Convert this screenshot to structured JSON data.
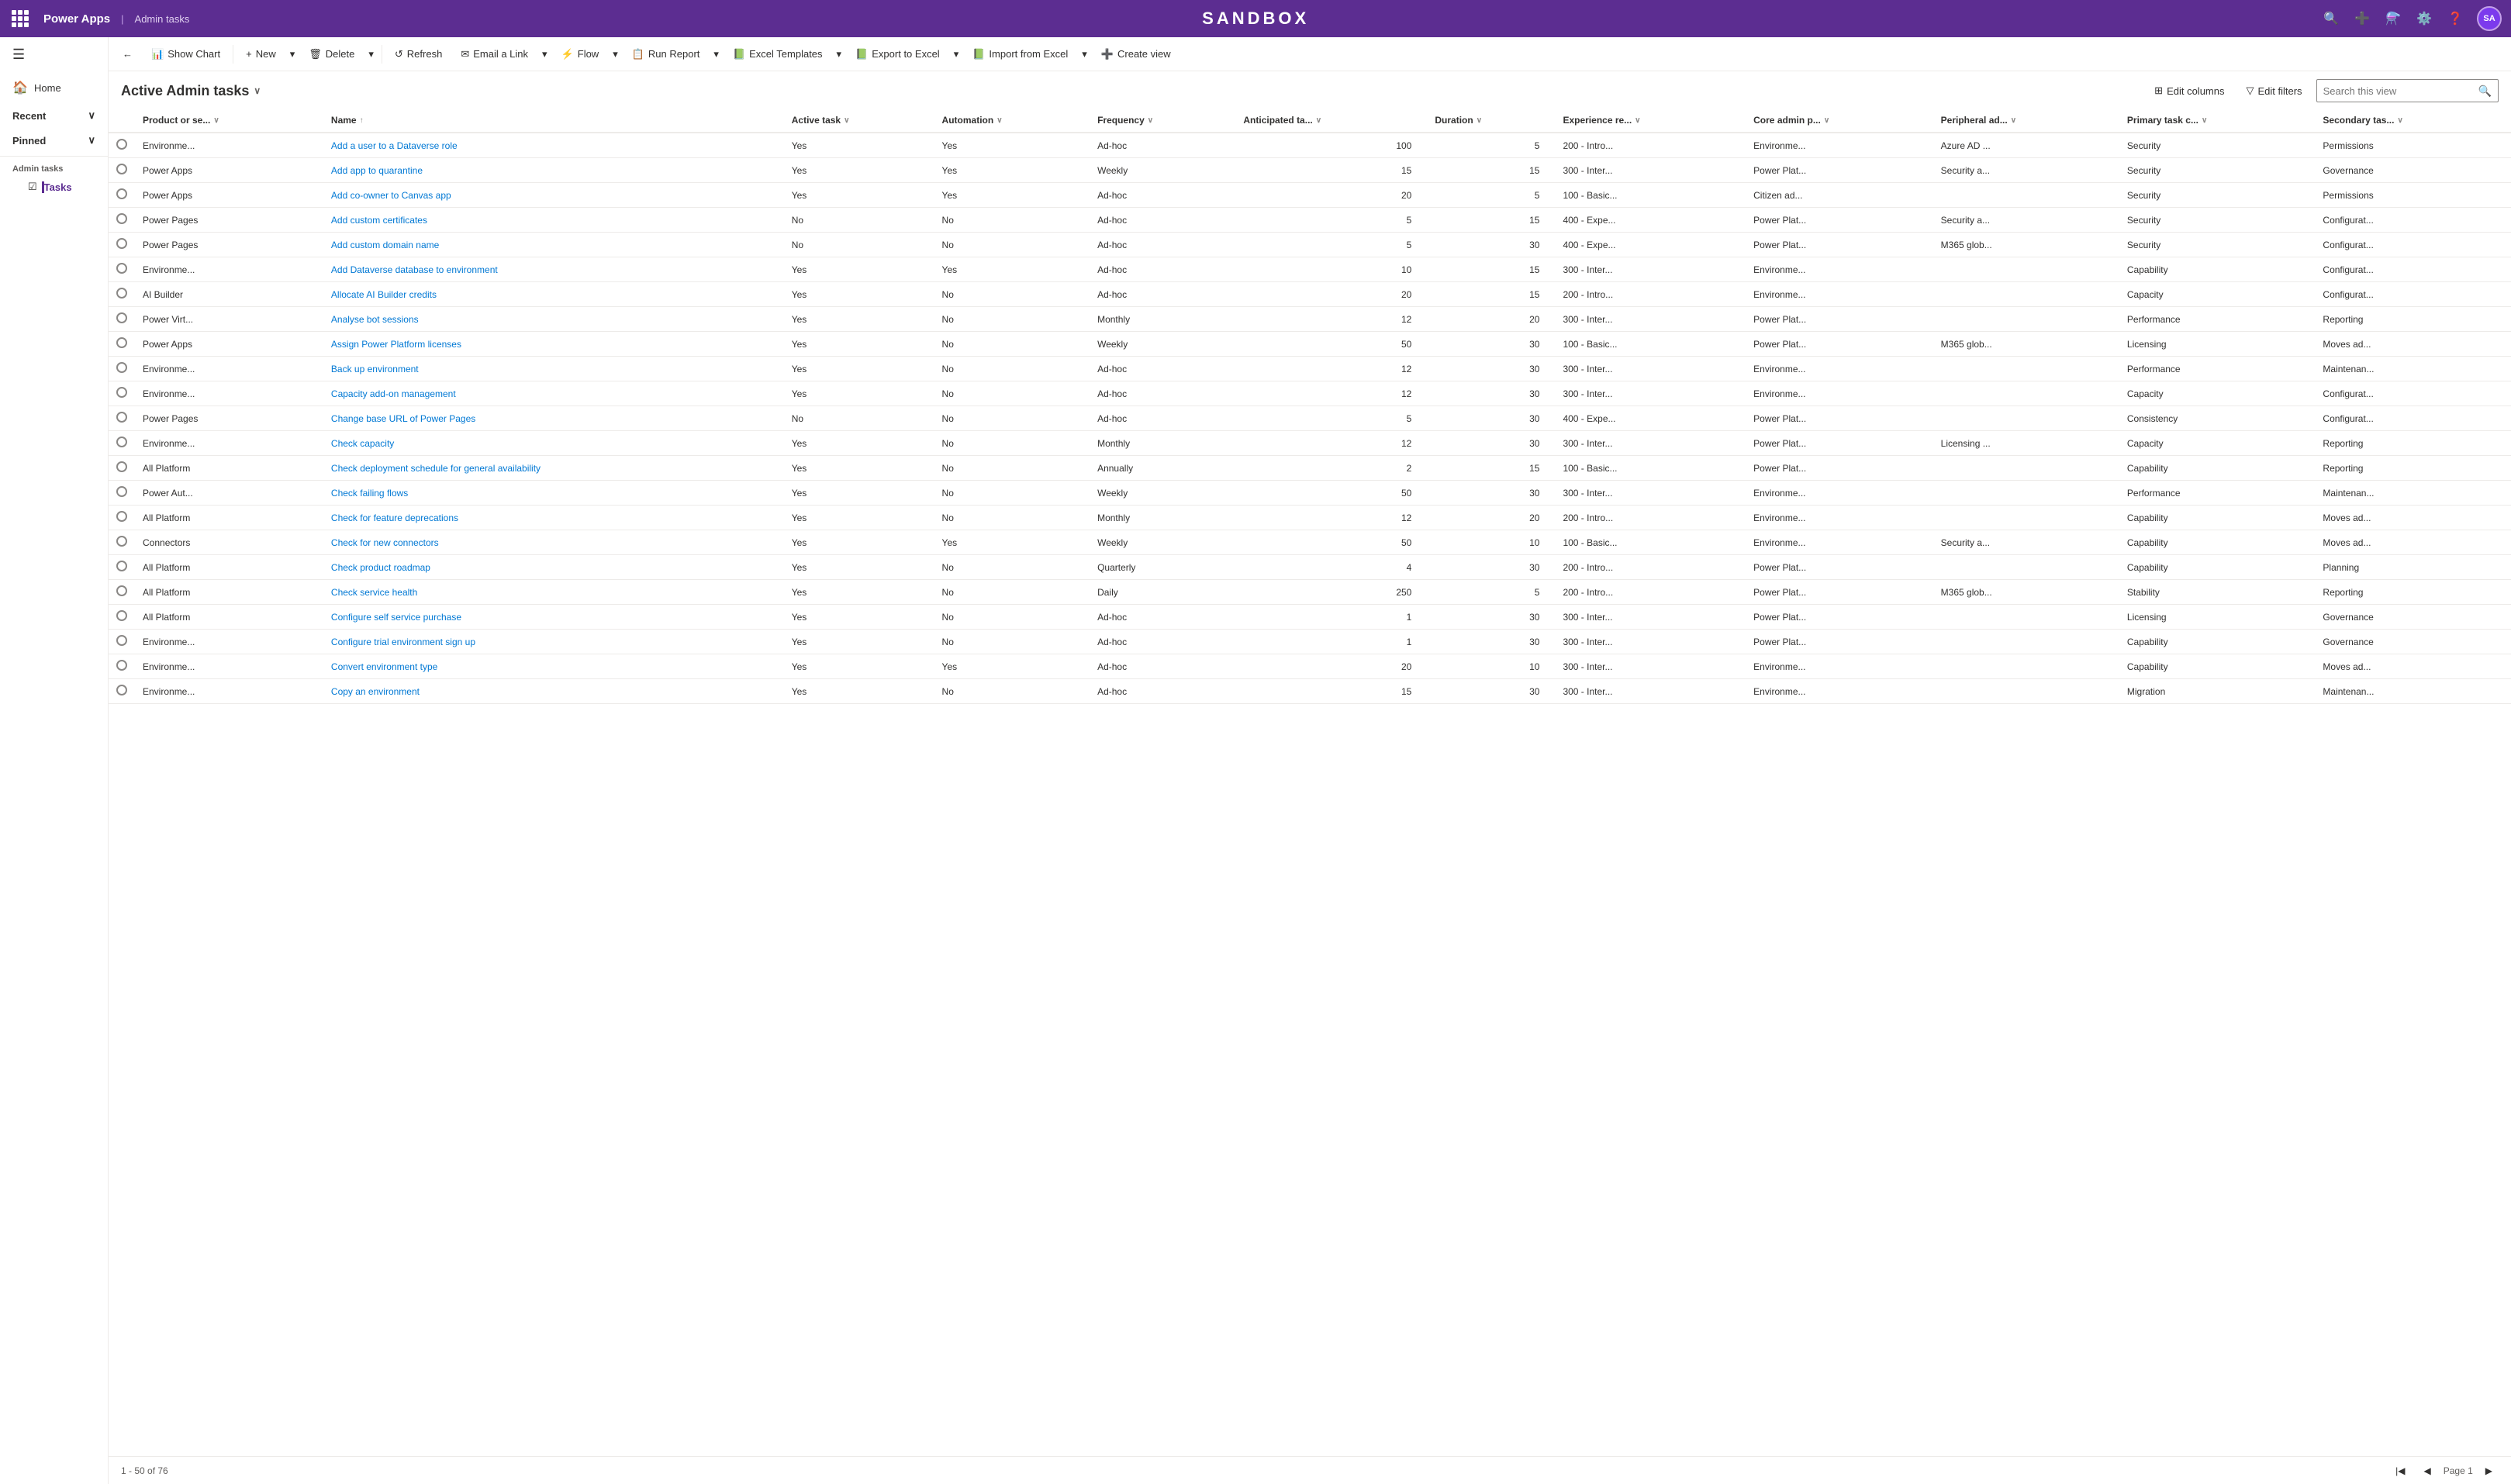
{
  "topNav": {
    "appName": "Power Apps",
    "breadcrumb": "Admin tasks",
    "title": "SANDBOX",
    "avatarText": "SA"
  },
  "sidebar": {
    "hamburgerLabel": "☰",
    "homeLabel": "Home",
    "recentLabel": "Recent",
    "pinnedLabel": "Pinned",
    "sectionLabel": "Admin tasks",
    "tasksLabel": "Tasks"
  },
  "commandBar": {
    "backLabel": "←",
    "showChartLabel": "Show Chart",
    "newLabel": "+ New",
    "deleteLabel": "🗑 Delete",
    "refreshLabel": "↺ Refresh",
    "emailLinkLabel": "✉ Email a Link",
    "flowLabel": "⚡ Flow",
    "runReportLabel": "📊 Run Report",
    "excelTemplatesLabel": "📋 Excel Templates",
    "exportExcelLabel": "📗 Export to Excel",
    "importExcelLabel": "📗 Import from Excel",
    "createViewLabel": "➕ Create view"
  },
  "viewHeader": {
    "title": "Active Admin tasks",
    "editColumnsLabel": "Edit columns",
    "editFiltersLabel": "Edit filters",
    "searchPlaceholder": "Search this view"
  },
  "columns": [
    {
      "id": "product",
      "label": "Product or se...",
      "width": "120"
    },
    {
      "id": "name",
      "label": "Name",
      "width": "260"
    },
    {
      "id": "active",
      "label": "Active task",
      "width": "80"
    },
    {
      "id": "automation",
      "label": "Automation",
      "width": "80"
    },
    {
      "id": "frequency",
      "label": "Frequency",
      "width": "90"
    },
    {
      "id": "anticipated",
      "label": "Anticipated ta...",
      "width": "110"
    },
    {
      "id": "duration",
      "label": "Duration",
      "width": "70"
    },
    {
      "id": "experience",
      "label": "Experience re...",
      "width": "110"
    },
    {
      "id": "coreAdmin",
      "label": "Core admin p...",
      "width": "110"
    },
    {
      "id": "peripheral",
      "label": "Peripheral ad...",
      "width": "100"
    },
    {
      "id": "primaryTask",
      "label": "Primary task c...",
      "width": "110"
    },
    {
      "id": "secondaryTask",
      "label": "Secondary tas...",
      "width": "110"
    }
  ],
  "rows": [
    {
      "product": "Environme...",
      "name": "Add a user to a Dataverse role",
      "active": "Yes",
      "automation": "Yes",
      "frequency": "Ad-hoc",
      "anticipated": "100",
      "duration": "5",
      "experience": "200 - Intro...",
      "coreAdmin": "Environme...",
      "peripheral": "Azure AD ...",
      "primaryTask": "Security",
      "secondaryTask": "Permissions"
    },
    {
      "product": "Power Apps",
      "name": "Add app to quarantine",
      "active": "Yes",
      "automation": "Yes",
      "frequency": "Weekly",
      "anticipated": "15",
      "duration": "15",
      "experience": "300 - Inter...",
      "coreAdmin": "Power Plat...",
      "peripheral": "Security a...",
      "primaryTask": "Security",
      "secondaryTask": "Governance"
    },
    {
      "product": "Power Apps",
      "name": "Add co-owner to Canvas app",
      "active": "Yes",
      "automation": "Yes",
      "frequency": "Ad-hoc",
      "anticipated": "20",
      "duration": "5",
      "experience": "100 - Basic...",
      "coreAdmin": "Citizen ad...",
      "peripheral": "",
      "primaryTask": "Security",
      "secondaryTask": "Permissions"
    },
    {
      "product": "Power Pages",
      "name": "Add custom certificates",
      "active": "No",
      "automation": "No",
      "frequency": "Ad-hoc",
      "anticipated": "5",
      "duration": "15",
      "experience": "400 - Expe...",
      "coreAdmin": "Power Plat...",
      "peripheral": "Security a...",
      "primaryTask": "Security",
      "secondaryTask": "Configurat..."
    },
    {
      "product": "Power Pages",
      "name": "Add custom domain name",
      "active": "No",
      "automation": "No",
      "frequency": "Ad-hoc",
      "anticipated": "5",
      "duration": "30",
      "experience": "400 - Expe...",
      "coreAdmin": "Power Plat...",
      "peripheral": "M365 glob...",
      "primaryTask": "Security",
      "secondaryTask": "Configurat..."
    },
    {
      "product": "Environme...",
      "name": "Add Dataverse database to environment",
      "active": "Yes",
      "automation": "Yes",
      "frequency": "Ad-hoc",
      "anticipated": "10",
      "duration": "15",
      "experience": "300 - Inter...",
      "coreAdmin": "Environme...",
      "peripheral": "",
      "primaryTask": "Capability",
      "secondaryTask": "Configurat..."
    },
    {
      "product": "AI Builder",
      "name": "Allocate AI Builder credits",
      "active": "Yes",
      "automation": "No",
      "frequency": "Ad-hoc",
      "anticipated": "20",
      "duration": "15",
      "experience": "200 - Intro...",
      "coreAdmin": "Environme...",
      "peripheral": "",
      "primaryTask": "Capacity",
      "secondaryTask": "Configurat..."
    },
    {
      "product": "Power Virt...",
      "name": "Analyse bot sessions",
      "active": "Yes",
      "automation": "No",
      "frequency": "Monthly",
      "anticipated": "12",
      "duration": "20",
      "experience": "300 - Inter...",
      "coreAdmin": "Power Plat...",
      "peripheral": "",
      "primaryTask": "Performance",
      "secondaryTask": "Reporting"
    },
    {
      "product": "Power Apps",
      "name": "Assign Power Platform licenses",
      "active": "Yes",
      "automation": "No",
      "frequency": "Weekly",
      "anticipated": "50",
      "duration": "30",
      "experience": "100 - Basic...",
      "coreAdmin": "Power Plat...",
      "peripheral": "M365 glob...",
      "primaryTask": "Licensing",
      "secondaryTask": "Moves ad..."
    },
    {
      "product": "Environme...",
      "name": "Back up environment",
      "active": "Yes",
      "automation": "No",
      "frequency": "Ad-hoc",
      "anticipated": "12",
      "duration": "30",
      "experience": "300 - Inter...",
      "coreAdmin": "Environme...",
      "peripheral": "",
      "primaryTask": "Performance",
      "secondaryTask": "Maintenan..."
    },
    {
      "product": "Environme...",
      "name": "Capacity add-on management",
      "active": "Yes",
      "automation": "No",
      "frequency": "Ad-hoc",
      "anticipated": "12",
      "duration": "30",
      "experience": "300 - Inter...",
      "coreAdmin": "Environme...",
      "peripheral": "",
      "primaryTask": "Capacity",
      "secondaryTask": "Configurat..."
    },
    {
      "product": "Power Pages",
      "name": "Change base URL of Power Pages",
      "active": "No",
      "automation": "No",
      "frequency": "Ad-hoc",
      "anticipated": "5",
      "duration": "30",
      "experience": "400 - Expe...",
      "coreAdmin": "Power Plat...",
      "peripheral": "",
      "primaryTask": "Consistency",
      "secondaryTask": "Configurat..."
    },
    {
      "product": "Environme...",
      "name": "Check capacity",
      "active": "Yes",
      "automation": "No",
      "frequency": "Monthly",
      "anticipated": "12",
      "duration": "30",
      "experience": "300 - Inter...",
      "coreAdmin": "Power Plat...",
      "peripheral": "Licensing ...",
      "primaryTask": "Capacity",
      "secondaryTask": "Reporting"
    },
    {
      "product": "All Platform",
      "name": "Check deployment schedule for general availability",
      "active": "Yes",
      "automation": "No",
      "frequency": "Annually",
      "anticipated": "2",
      "duration": "15",
      "experience": "100 - Basic...",
      "coreAdmin": "Power Plat...",
      "peripheral": "",
      "primaryTask": "Capability",
      "secondaryTask": "Reporting"
    },
    {
      "product": "Power Aut...",
      "name": "Check failing flows",
      "active": "Yes",
      "automation": "No",
      "frequency": "Weekly",
      "anticipated": "50",
      "duration": "30",
      "experience": "300 - Inter...",
      "coreAdmin": "Environme...",
      "peripheral": "",
      "primaryTask": "Performance",
      "secondaryTask": "Maintenan..."
    },
    {
      "product": "All Platform",
      "name": "Check for feature deprecations",
      "active": "Yes",
      "automation": "No",
      "frequency": "Monthly",
      "anticipated": "12",
      "duration": "20",
      "experience": "200 - Intro...",
      "coreAdmin": "Environme...",
      "peripheral": "",
      "primaryTask": "Capability",
      "secondaryTask": "Moves ad..."
    },
    {
      "product": "Connectors",
      "name": "Check for new connectors",
      "active": "Yes",
      "automation": "Yes",
      "frequency": "Weekly",
      "anticipated": "50",
      "duration": "10",
      "experience": "100 - Basic...",
      "coreAdmin": "Environme...",
      "peripheral": "Security a...",
      "primaryTask": "Capability",
      "secondaryTask": "Moves ad..."
    },
    {
      "product": "All Platform",
      "name": "Check product roadmap",
      "active": "Yes",
      "automation": "No",
      "frequency": "Quarterly",
      "anticipated": "4",
      "duration": "30",
      "experience": "200 - Intro...",
      "coreAdmin": "Power Plat...",
      "peripheral": "",
      "primaryTask": "Capability",
      "secondaryTask": "Planning"
    },
    {
      "product": "All Platform",
      "name": "Check service health",
      "active": "Yes",
      "automation": "No",
      "frequency": "Daily",
      "anticipated": "250",
      "duration": "5",
      "experience": "200 - Intro...",
      "coreAdmin": "Power Plat...",
      "peripheral": "M365 glob...",
      "primaryTask": "Stability",
      "secondaryTask": "Reporting"
    },
    {
      "product": "All Platform",
      "name": "Configure self service purchase",
      "active": "Yes",
      "automation": "No",
      "frequency": "Ad-hoc",
      "anticipated": "1",
      "duration": "30",
      "experience": "300 - Inter...",
      "coreAdmin": "Power Plat...",
      "peripheral": "",
      "primaryTask": "Licensing",
      "secondaryTask": "Governance"
    },
    {
      "product": "Environme...",
      "name": "Configure trial environment sign up",
      "active": "Yes",
      "automation": "No",
      "frequency": "Ad-hoc",
      "anticipated": "1",
      "duration": "30",
      "experience": "300 - Inter...",
      "coreAdmin": "Power Plat...",
      "peripheral": "",
      "primaryTask": "Capability",
      "secondaryTask": "Governance"
    },
    {
      "product": "Environme...",
      "name": "Convert environment type",
      "active": "Yes",
      "automation": "Yes",
      "frequency": "Ad-hoc",
      "anticipated": "20",
      "duration": "10",
      "experience": "300 - Inter...",
      "coreAdmin": "Environme...",
      "peripheral": "",
      "primaryTask": "Capability",
      "secondaryTask": "Moves ad..."
    },
    {
      "product": "Environme...",
      "name": "Copy an environment",
      "active": "Yes",
      "automation": "No",
      "frequency": "Ad-hoc",
      "anticipated": "15",
      "duration": "30",
      "experience": "300 - Inter...",
      "coreAdmin": "Environme...",
      "peripheral": "",
      "primaryTask": "Migration",
      "secondaryTask": "Maintenan..."
    }
  ],
  "footer": {
    "recordCount": "1 - 50 of 76",
    "pageLabel": "Page 1"
  }
}
